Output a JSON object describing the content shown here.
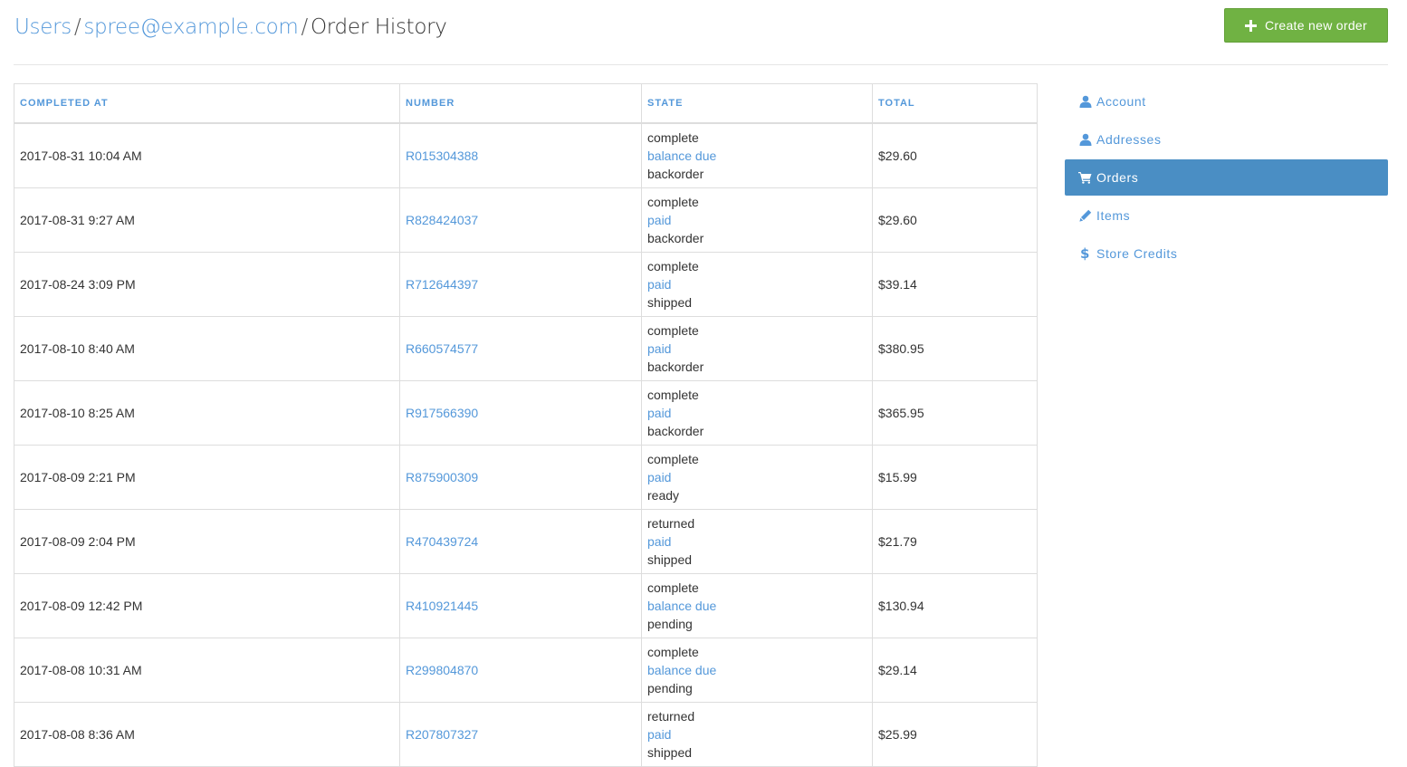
{
  "breadcrumb": {
    "users": "Users",
    "separator": "/",
    "email": "spree@example.com",
    "current": "Order History"
  },
  "actions": {
    "create_label": "Create new order",
    "create_icon": "plus-icon"
  },
  "table": {
    "headers": {
      "completed_at": "COMPLETED AT",
      "number": "NUMBER",
      "state": "STATE",
      "total": "TOTAL"
    },
    "rows": [
      {
        "completed_at": "2017-08-31 10:04 AM",
        "number": "R015304388",
        "state": "complete",
        "payment_state": "balance due",
        "shipment_state": "backorder",
        "total": "$29.60"
      },
      {
        "completed_at": "2017-08-31 9:27 AM",
        "number": "R828424037",
        "state": "complete",
        "payment_state": "paid",
        "shipment_state": "backorder",
        "total": "$29.60"
      },
      {
        "completed_at": "2017-08-24 3:09 PM",
        "number": "R712644397",
        "state": "complete",
        "payment_state": "paid",
        "shipment_state": "shipped",
        "total": "$39.14"
      },
      {
        "completed_at": "2017-08-10 8:40 AM",
        "number": "R660574577",
        "state": "complete",
        "payment_state": "paid",
        "shipment_state": "backorder",
        "total": "$380.95"
      },
      {
        "completed_at": "2017-08-10 8:25 AM",
        "number": "R917566390",
        "state": "complete",
        "payment_state": "paid",
        "shipment_state": "backorder",
        "total": "$365.95"
      },
      {
        "completed_at": "2017-08-09 2:21 PM",
        "number": "R875900309",
        "state": "complete",
        "payment_state": "paid",
        "shipment_state": "ready",
        "total": "$15.99"
      },
      {
        "completed_at": "2017-08-09 2:04 PM",
        "number": "R470439724",
        "state": "returned",
        "payment_state": "paid",
        "shipment_state": "shipped",
        "total": "$21.79"
      },
      {
        "completed_at": "2017-08-09 12:42 PM",
        "number": "R410921445",
        "state": "complete",
        "payment_state": "balance due",
        "shipment_state": "pending",
        "total": "$130.94"
      },
      {
        "completed_at": "2017-08-08 10:31 AM",
        "number": "R299804870",
        "state": "complete",
        "payment_state": "balance due",
        "shipment_state": "pending",
        "total": "$29.14"
      },
      {
        "completed_at": "2017-08-08 8:36 AM",
        "number": "R207807327",
        "state": "returned",
        "payment_state": "paid",
        "shipment_state": "shipped",
        "total": "$25.99"
      }
    ]
  },
  "sidebar": {
    "items": [
      {
        "label": "Account",
        "icon": "user-icon",
        "active": false
      },
      {
        "label": "Addresses",
        "icon": "user-icon",
        "active": false
      },
      {
        "label": "Orders",
        "icon": "cart-icon",
        "active": true
      },
      {
        "label": "Items",
        "icon": "pencil-icon",
        "active": false
      },
      {
        "label": "Store Credits",
        "icon": "dollar-icon",
        "active": false
      }
    ]
  },
  "colors": {
    "link": "#5498da",
    "active_nav": "#4a8ec4",
    "create_button": "#70b243"
  }
}
